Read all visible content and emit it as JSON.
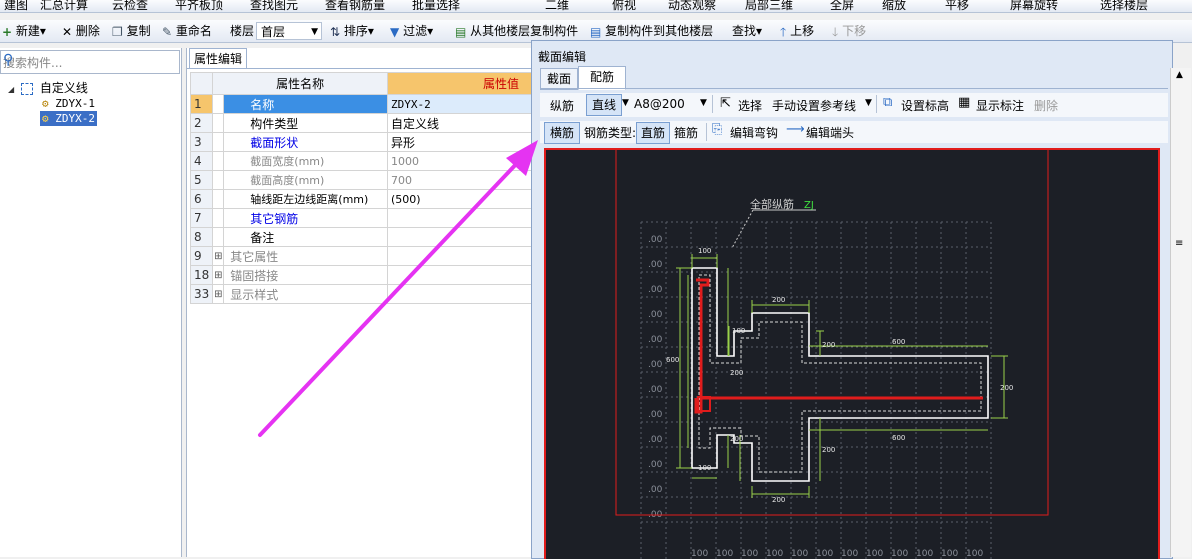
{
  "toolbar1": {
    "items": [
      "建图",
      "汇总计算",
      "云检查",
      "平齐板顶",
      "查找图元",
      "查看钢筋量",
      "批量选择",
      "二维",
      "俯视",
      "动态观察",
      "局部三维",
      "全屏",
      "缩放",
      "平移",
      "屏幕旋转",
      "选择楼层"
    ]
  },
  "toolbar2": {
    "new": "新建",
    "delete": "删除",
    "copy": "复制",
    "rename": "重命名",
    "floor_label": "楼层",
    "floor_value": "首层",
    "sort": "排序",
    "filter": "过滤",
    "copy_from_floor": "从其他楼层复制构件",
    "copy_to_floor": "复制构件到其他楼层",
    "find": "查找",
    "move_up": "上移",
    "move_down": "下移"
  },
  "tree": {
    "search_placeholder": "搜索构件...",
    "root": "自定义线",
    "children": [
      "ZDYX-1",
      "ZDYX-2"
    ]
  },
  "props": {
    "tab": "属性编辑",
    "col_name": "属性名称",
    "col_value": "属性值",
    "rows": [
      {
        "n": "1",
        "name": "名称",
        "value": "ZDYX-2"
      },
      {
        "n": "2",
        "name": "构件类型",
        "value": "自定义线"
      },
      {
        "n": "3",
        "name": "截面形状",
        "value": "异形"
      },
      {
        "n": "4",
        "name": "截面宽度(mm)",
        "value": "1000"
      },
      {
        "n": "5",
        "name": "截面高度(mm)",
        "value": "700"
      },
      {
        "n": "6",
        "name": "轴线距左边线距离(mm)",
        "value": "(500)"
      },
      {
        "n": "7",
        "name": "其它钢筋",
        "value": ""
      },
      {
        "n": "8",
        "name": "备注",
        "value": ""
      },
      {
        "n": "9",
        "name": "其它属性",
        "value": ""
      },
      {
        "n": "18",
        "name": "锚固搭接",
        "value": ""
      },
      {
        "n": "33",
        "name": "显示样式",
        "value": ""
      }
    ]
  },
  "dialog": {
    "title": "截面编辑",
    "tabs": [
      "截面",
      "配筋"
    ],
    "row1": {
      "zongjin": "纵筋",
      "mode": "直线",
      "spec": "A8@200",
      "select": "选择",
      "ref_line": "手动设置参考线",
      "set_elev": "设置标高",
      "show_label": "显示标注",
      "delete": "删除"
    },
    "row2": {
      "hengjin": "横筋",
      "type_label": "钢筋类型:",
      "straight": "直筋",
      "stirrup": "箍筋",
      "edit_hook": "编辑弯钩",
      "edit_end": "编辑端头"
    }
  },
  "drawing": {
    "annotation": "全部纵筋",
    "annotation_code": "ZJ",
    "dims": [
      "100",
      "200",
      "600",
      "100",
      "200",
      "200",
      "600",
      "100",
      "200",
      "200",
      "600",
      "200",
      "200",
      "200",
      "600",
      "100",
      "200"
    ],
    "ruler_labels": [
      "100",
      "100",
      "100",
      "100",
      "100",
      "100",
      "100",
      "100",
      "100",
      "100",
      "100",
      "100",
      "100",
      "100",
      "100"
    ],
    "left_labels": [
      ".00",
      ".00",
      ".00",
      ".00",
      ".00",
      ".00",
      ".00",
      ".00",
      ".00",
      ".00",
      ".00",
      ".00",
      ".00",
      ".00",
      ".00"
    ]
  },
  "colors": {
    "accent_orange": "#f6c56c",
    "canvas_bg": "#1c1f26",
    "rebar_red": "#e01c1c",
    "dim_green": "#9ad14a",
    "arrow_magenta": "#e533f2"
  }
}
